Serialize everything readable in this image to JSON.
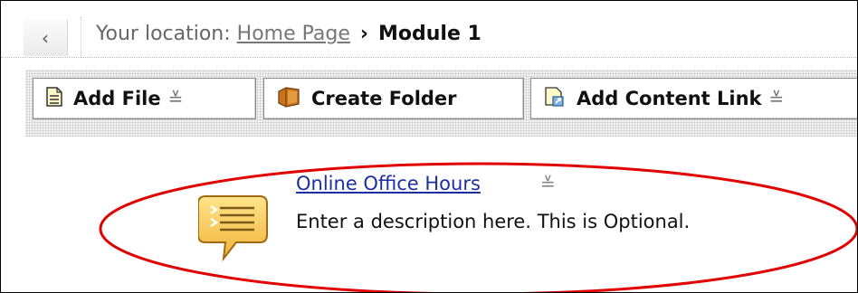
{
  "breadcrumb": {
    "back_glyph": "‹",
    "prefix": "Your location:",
    "home_link": "Home Page",
    "separator": "›",
    "current": "Module 1"
  },
  "toolbar": {
    "add_file_label": "Add File",
    "create_folder_label": "Create Folder",
    "add_content_link_label": "Add Content Link",
    "menu_glyph": "≚"
  },
  "content_item": {
    "title": "Online Office Hours",
    "description": "Enter a description here. This is Optional.",
    "icon": "chat-bubble-icon",
    "menu_glyph": "≚"
  },
  "annotation": {
    "shape": "ellipse",
    "color": "#e00000"
  }
}
